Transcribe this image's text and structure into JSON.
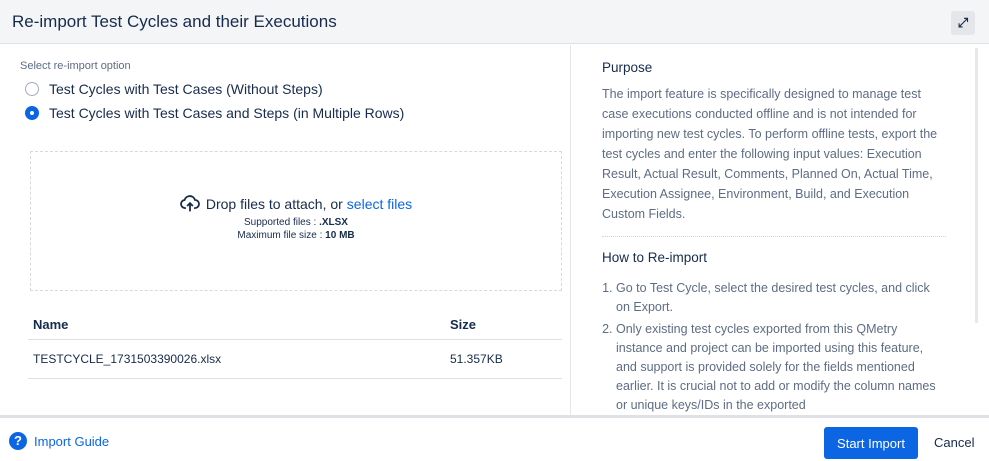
{
  "header": {
    "title": "Re-import Test Cycles and their Executions",
    "expand_icon": "fullscreen-icon"
  },
  "options": {
    "label": "Select re-import option",
    "items": [
      {
        "label": "Test Cycles with Test Cases (Without Steps)",
        "selected": false
      },
      {
        "label": "Test Cycles with Test Cases and Steps (in Multiple Rows)",
        "selected": true
      }
    ]
  },
  "dropzone": {
    "text": "Drop files to attach, or",
    "link": "select files",
    "supported_label": "Supported files : ",
    "supported_value": ".XLSX",
    "max_label": "Maximum file size : ",
    "max_value": "10 MB",
    "icon": "cloud-upload-icon"
  },
  "files": {
    "headers": [
      "Name",
      "Size"
    ],
    "rows": [
      {
        "name": "TESTCYCLE_1731503390026.xlsx",
        "size": "51.357KB"
      }
    ]
  },
  "help": {
    "purpose_title": "Purpose",
    "purpose_text": "The import feature is specifically designed to manage test case executions conducted offline and is not intended for importing new test cycles. To perform offline tests, export the test cycles and enter the following input values: Execution Result, Actual Result, Comments, Planned On, Actual Time, Execution Assignee, Environment, Build, and Execution Custom Fields.",
    "howto_title": "How to Re-import",
    "steps": [
      "Go to Test Cycle, select the desired test cycles, and click on Export.",
      "Only existing test cycles exported from this QMetry instance and project can be imported using this feature, and support is provided solely for the fields mentioned earlier. It is crucial not to add or modify the column names or unique keys/IDs in the exported"
    ]
  },
  "footer": {
    "guide": "Import Guide",
    "start": "Start Import",
    "cancel": "Cancel",
    "accent": "#0c66e4"
  }
}
